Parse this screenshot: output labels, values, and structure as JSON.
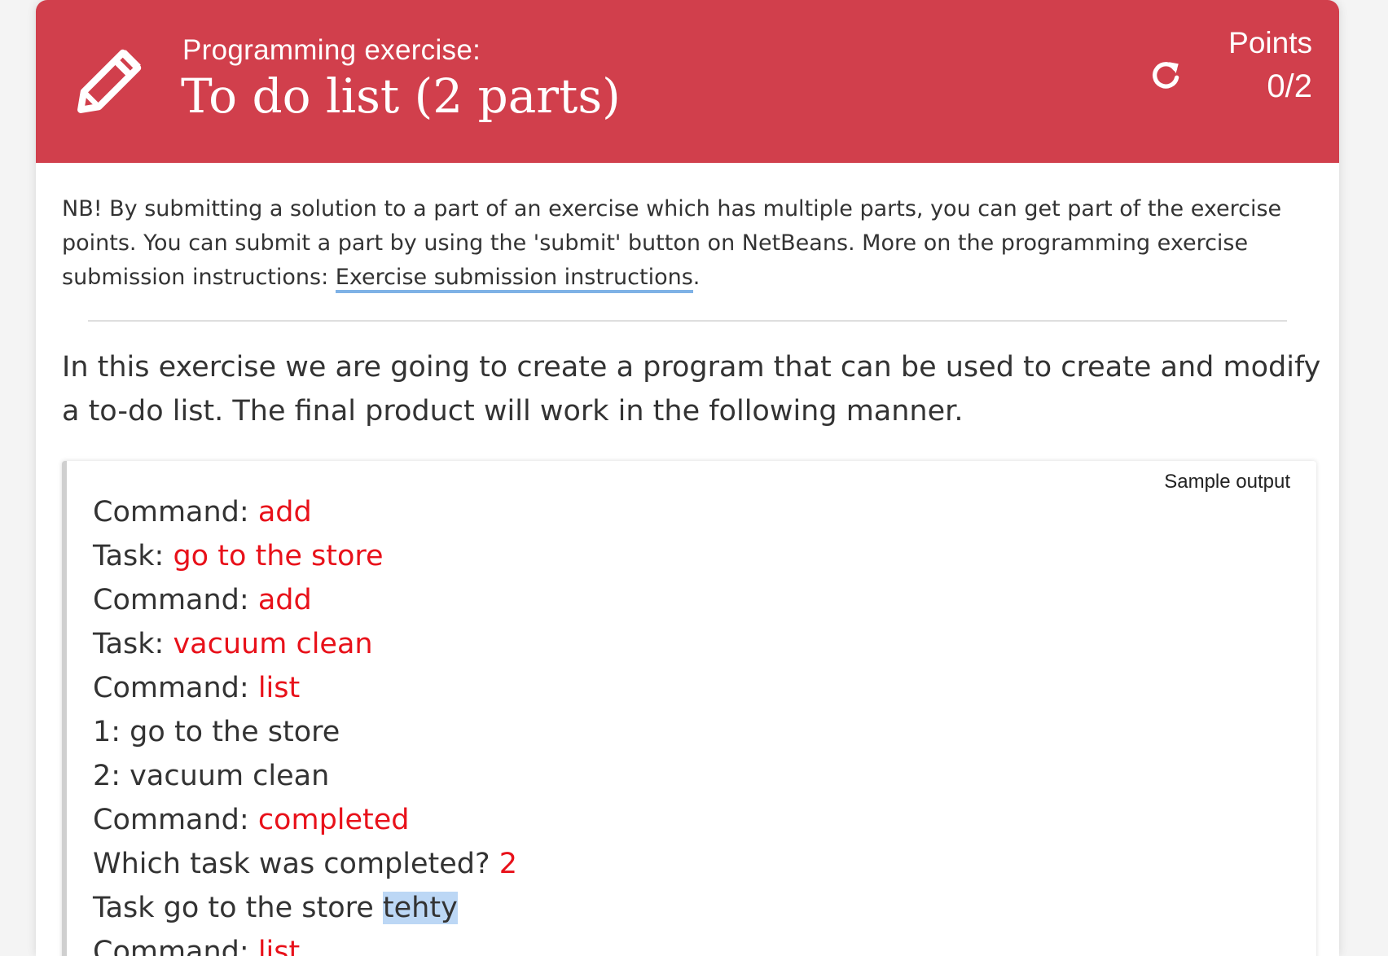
{
  "header": {
    "kicker": "Programming exercise:",
    "title": "To do list (2 parts)",
    "points_label": "Points",
    "points_value": "0/2",
    "icon": "pencil-icon",
    "refresh_icon": "refresh-icon",
    "color": "#d13f4c"
  },
  "notice": {
    "text": "NB! By submitting a solution to a part of an exercise which has multiple parts, you can get part of the exercise points. You can submit a part by using the 'submit' button on NetBeans. More on the programming exercise submission instructions: ",
    "link": "Exercise submission instructions",
    "after": "."
  },
  "intro": "In this exercise we are going to create a program that can be used to create and modify a to-do list. The final product will work in the following manner.",
  "sample": {
    "label": "Sample output",
    "lines": [
      {
        "prefix": "Command: ",
        "input": "add"
      },
      {
        "prefix": "Task: ",
        "input": "go to the store"
      },
      {
        "prefix": "Command: ",
        "input": "add"
      },
      {
        "prefix": "Task: ",
        "input": "vacuum clean"
      },
      {
        "prefix": "Command: ",
        "input": "list"
      },
      {
        "prefix": "1: go to the store",
        "input": ""
      },
      {
        "prefix": "2: vacuum clean",
        "input": ""
      },
      {
        "prefix": "Command: ",
        "input": "completed"
      },
      {
        "prefix": "Which task was completed? ",
        "input": "2"
      },
      {
        "prefix": "Task go to the store ",
        "input": "",
        "highlight": "tehty"
      },
      {
        "prefix": "Command: ",
        "input": "list"
      }
    ]
  }
}
